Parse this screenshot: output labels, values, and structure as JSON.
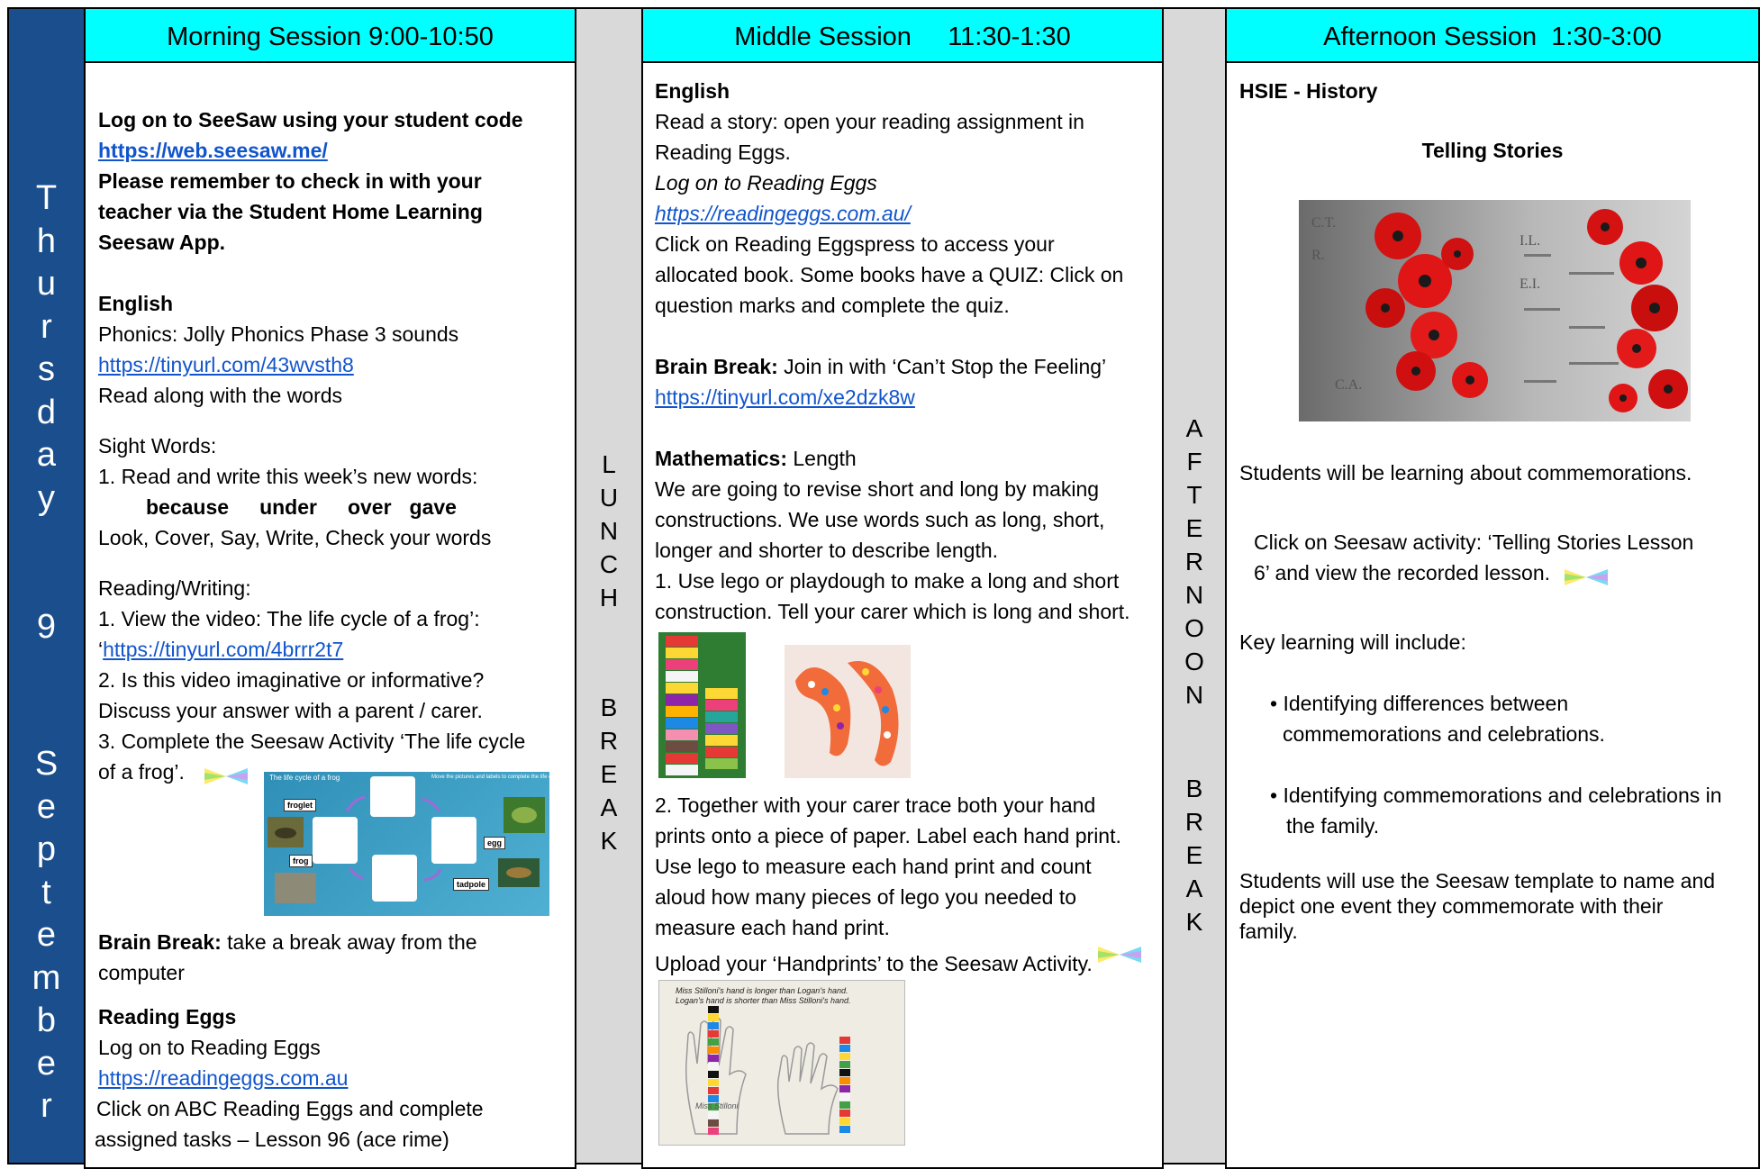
{
  "day": {
    "letters_top": [
      "T",
      "h",
      "u",
      "r",
      "s",
      "d",
      "a",
      "y"
    ],
    "number": "9",
    "letters_bottom": [
      "S",
      "e",
      "p",
      "t",
      "e",
      "m",
      "b",
      "e",
      "r"
    ]
  },
  "lunch": {
    "letters_top": [
      "L",
      "U",
      "N",
      "C",
      "H"
    ],
    "letters_bottom": [
      "B",
      "R",
      "E",
      "A",
      "K"
    ]
  },
  "afternoon_break": {
    "letters_top": [
      "A",
      "F",
      "T",
      "E",
      "R",
      "N",
      "O",
      "O",
      "N"
    ],
    "letters_bottom": [
      "B",
      "R",
      "E",
      "A",
      "K"
    ]
  },
  "morning": {
    "header": "Morning Session 9:00-10:50",
    "login_line": "Log on to SeeSaw using your student code",
    "login_link": "https://web.seesaw.me/",
    "checkin_1": "Please remember to check in with your",
    "checkin_2": "teacher via the Student Home Learning",
    "checkin_3": "Seesaw App.",
    "english_title": "English",
    "phonics": "Phonics: Jolly Phonics Phase 3 sounds",
    "phonics_link": "https://tinyurl.com/43wvsth8",
    "read_along": "Read along with the words",
    "sight_words": "Sight Words:",
    "sight_1": "1. Read and write this week’s new words:",
    "words": [
      "because",
      "under",
      "over",
      "gave"
    ],
    "look_cover": "Look, Cover, Say, Write, Check your words",
    "reading_writing": "Reading/Writing:",
    "rw_1": "1. View the video: The life cycle of a frog’:",
    "rw_1_prefix": "‘",
    "rw_1_link": "https://tinyurl.com/4brrr2t7",
    "rw_2": "2. Is this video imaginative or informative?",
    "rw_2b": "Discuss your answer with a parent / carer.",
    "rw_3": "3. Complete the Seesaw Activity ‘The life cycle",
    "rw_3b": "of a frog’.",
    "brain_label": "Brain Break:",
    "brain_text": " take a break away from the",
    "brain_text2": "computer",
    "eggs_title": "Reading Eggs",
    "eggs_login": "Log on to Reading Eggs",
    "eggs_link": "https://readingeggs.com.au",
    "eggs_click": "Click on ABC Reading Eggs and complete",
    "eggs_tasks": "assigned  tasks – Lesson 96 (ace rime)",
    "frog_img": {
      "title": "The life cycle of a frog",
      "instructions": "Move the pictures and labels to complete the life cycle",
      "labels": [
        "froglet",
        "frog",
        "egg",
        "tadpole"
      ]
    }
  },
  "middle": {
    "header": "Middle Session     11:30-1:30",
    "english_title": "English",
    "story_1": "Read a story: open your reading assignment in",
    "story_2": "Reading Eggs.",
    "login_italic": "Log on to Reading Eggs",
    "eggs_link": "https://readingeggs.com.au/",
    "click_1": "Click on Reading Eggspress to access your",
    "click_2": "allocated book. Some books have a QUIZ: Click on",
    "click_3": "question marks and complete the quiz.",
    "brain_label": "Brain Break:",
    "brain_text": " Join in with ‘Can’t Stop the Feeling’",
    "brain_link": "https://tinyurl.com/xe2dzk8w",
    "maths_label": "Mathematics:",
    "maths_text": " Length",
    "m1": "We are going to revise short and long by making",
    "m2": "constructions. We use words such as long, short,",
    "m3": "longer and shorter to describe length.",
    "m4": "1. Use lego or playdough to make a long and short",
    "m5": "construction. Tell your carer which is long and short.",
    "t1": "2. Together with your carer trace  both your hand",
    "t2": "prints onto a piece of paper. Label each hand print.",
    "t3": "Use lego to measure each hand print and count",
    "t4": "aloud how many pieces of lego you needed to",
    "t5": "measure each hand print.",
    "t6": "Upload your ‘Handprints’ to the Seesaw Activity.",
    "hand_note_1": "Miss Stilloni's hand is longer than Logan's hand.",
    "hand_note_2": "Logan's hand is shorter than Miss Stilloni's hand.",
    "hand_label": "Miss Stilloni"
  },
  "afternoon": {
    "header": "Afternoon Session  1:30-3:00",
    "subject": "HSIE - History",
    "title": "Telling Stories",
    "intro": "Students will be learning about commemorations.",
    "click_1": "Click on Seesaw activity: ‘Telling Stories Lesson",
    "click_2": "6’ and view the recorded lesson.",
    "key": "Key learning will include:",
    "b1a": "• Identifying differences between",
    "b1b": "commemorations and celebrations.",
    "b2a": "• Identifying commemorations and celebrations in",
    "b2b": "the family.",
    "s1": "Students will use the Seesaw template to name and",
    "s2": "depict one event they commemorate with their",
    "s3": "family.",
    "wall_names": [
      "C.T.",
      "R.",
      "C.A.",
      "E.I.",
      "I.L."
    ]
  },
  "colors": {
    "header_bg": "#00ffff",
    "day_bg": "#1a4e8c",
    "break_bg": "#d9d9d9",
    "link": "#1155cc"
  }
}
